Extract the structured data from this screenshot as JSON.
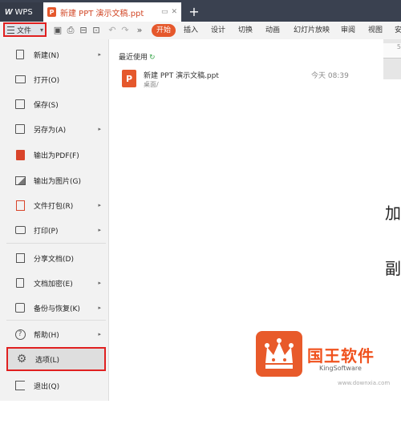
{
  "titlebar": {
    "app_tab": "WPS",
    "doc_tab": "新建 PPT 演示文稿.ppt",
    "new_tab": "+"
  },
  "toolbar": {
    "file_label": "文件",
    "start_label": "开始",
    "tabs": [
      "插入",
      "设计",
      "切换",
      "动画",
      "幻灯片放映",
      "审阅",
      "视图",
      "安"
    ]
  },
  "menu": {
    "items": [
      {
        "label": "新建(N)",
        "icon": "new-doc-icon",
        "arrow": true
      },
      {
        "label": "打开(O)",
        "icon": "folder-icon",
        "arrow": false
      },
      {
        "label": "保存(S)",
        "icon": "save-icon",
        "arrow": false
      },
      {
        "label": "另存为(A)",
        "icon": "save-as-icon",
        "arrow": true
      },
      {
        "label": "输出为PDF(F)",
        "icon": "pdf-icon",
        "arrow": false
      },
      {
        "label": "输出为图片(G)",
        "icon": "image-icon",
        "arrow": false
      },
      {
        "label": "文件打包(R)",
        "icon": "package-icon",
        "arrow": true
      },
      {
        "label": "打印(P)",
        "icon": "print-icon",
        "arrow": true
      },
      {
        "label": "分享文档(D)",
        "icon": "share-icon",
        "arrow": false
      },
      {
        "label": "文档加密(E)",
        "icon": "lock-icon",
        "arrow": true
      },
      {
        "label": "备份与恢复(K)",
        "icon": "backup-icon",
        "arrow": true
      },
      {
        "label": "帮助(H)",
        "icon": "help-icon",
        "arrow": true
      },
      {
        "label": "选项(L)",
        "icon": "gear-icon",
        "arrow": false
      },
      {
        "label": "退出(Q)",
        "icon": "exit-icon",
        "arrow": false
      }
    ]
  },
  "recent": {
    "title": "最近使用",
    "file_icon_letter": "P",
    "file_name": "新建 PPT 演示文稿.ppt",
    "file_path": "桌面/",
    "file_time": "今天 08:39"
  },
  "doc": {
    "ruler_number": "5",
    "char1": "加",
    "char2": "副"
  },
  "watermark": {
    "brand": "国王软件",
    "sub": "KingSoftware",
    "url": "www.downxia.com"
  },
  "colors": {
    "accent": "#e5582c",
    "highlight_border": "#e02020",
    "titlebar": "#3a4150"
  }
}
